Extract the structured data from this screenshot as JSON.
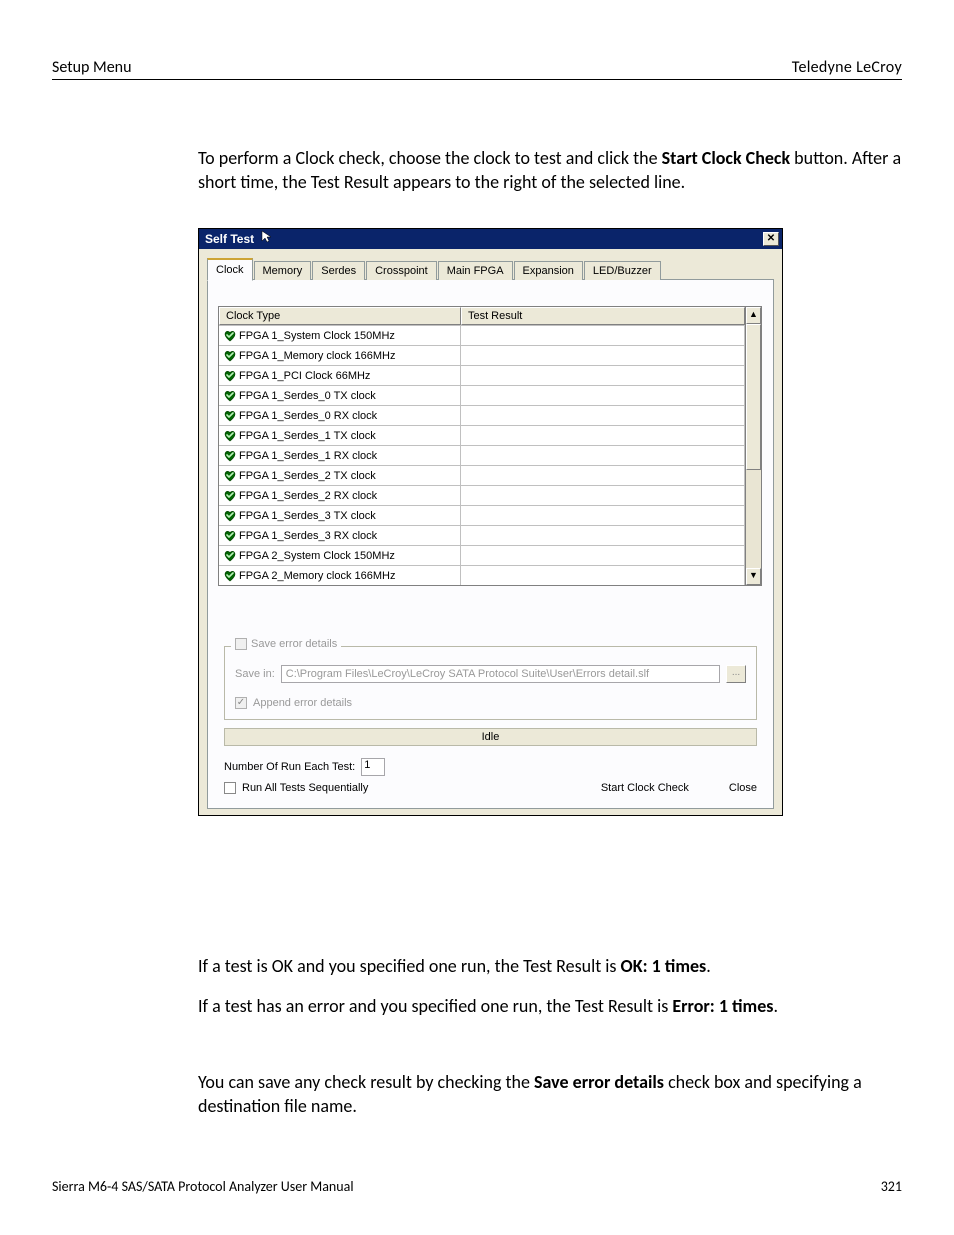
{
  "header": {
    "left": "Setup Menu",
    "right": "Teledyne LeCroy"
  },
  "para1": {
    "t1": "To perform a Clock check, choose the clock to test and click the ",
    "b1": "Start Clock Check",
    "t2": " button. After a short time, the Test Result appears to the right of the selected line."
  },
  "para2": {
    "t1": "If a test is OK and you specified one run, the Test Result is ",
    "b1": "OK: 1 times",
    "t2": "."
  },
  "para3": {
    "t1": "If a test has an error and you specified one run, the Test Result is ",
    "b1": "Error: 1 times",
    "t2": "."
  },
  "para4": {
    "t1": "You can save any check result by checking the ",
    "b1": "Save error details",
    "t2": " check box and specifying a destination file name."
  },
  "dialog": {
    "title": "Self Test",
    "close_label": "✕",
    "tabs": [
      {
        "label": "Clock",
        "active": true
      },
      {
        "label": "Memory",
        "active": false
      },
      {
        "label": "Serdes",
        "active": false
      },
      {
        "label": "Crosspoint",
        "active": false
      },
      {
        "label": "Main FPGA",
        "active": false
      },
      {
        "label": "Expansion",
        "active": false
      },
      {
        "label": "LED/Buzzer",
        "active": false
      }
    ],
    "table": {
      "col_clock_type": "Clock Type",
      "col_test_result": "Test Result",
      "rows": [
        {
          "name": "FPGA 1_System Clock 150MHz",
          "result": ""
        },
        {
          "name": "FPGA 1_Memory clock 166MHz",
          "result": ""
        },
        {
          "name": "FPGA 1_PCI Clock 66MHz",
          "result": ""
        },
        {
          "name": "FPGA 1_Serdes_0 TX clock",
          "result": ""
        },
        {
          "name": "FPGA 1_Serdes_0 RX clock",
          "result": ""
        },
        {
          "name": "FPGA 1_Serdes_1 TX clock",
          "result": ""
        },
        {
          "name": "FPGA 1_Serdes_1 RX clock",
          "result": ""
        },
        {
          "name": "FPGA 1_Serdes_2 TX clock",
          "result": ""
        },
        {
          "name": "FPGA 1_Serdes_2 RX clock",
          "result": ""
        },
        {
          "name": "FPGA 1_Serdes_3 TX clock",
          "result": ""
        },
        {
          "name": "FPGA 1_Serdes_3 RX clock",
          "result": ""
        },
        {
          "name": "FPGA 2_System Clock 150MHz",
          "result": ""
        },
        {
          "name": "FPGA 2_Memory clock 166MHz",
          "result": ""
        }
      ]
    },
    "save_error_details_label": "Save error details",
    "save_in_label": "Save in:",
    "save_in_path": "C:\\Program Files\\LeCroy\\LeCroy SATA Protocol Suite\\User\\Errors detail.slf",
    "browse_label": "...",
    "append_label": "Append error details",
    "status_text": "Idle",
    "num_label": "Number Of Run Each Test:",
    "num_value": "1",
    "run_all_label": "Run All Tests Sequentially",
    "start_label": "Start Clock Check",
    "close_btn_label": "Close",
    "scroll_up": "▲",
    "scroll_down": "▼"
  },
  "footer": {
    "left": "Sierra M6-4 SAS/SATA Protocol Analyzer User Manual",
    "right": "321"
  }
}
